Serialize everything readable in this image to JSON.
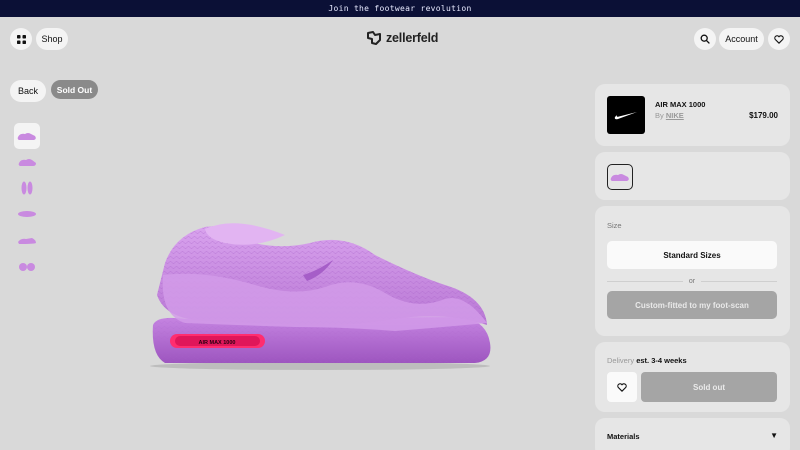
{
  "banner": {
    "text": "Join the footwear revolution"
  },
  "header": {
    "menu_icon": "grid-icon",
    "shop_label": "Shop",
    "brand_name": "zellerfeld",
    "search_icon": "search-icon",
    "account_label": "Account",
    "wishlist_icon": "heart-icon"
  },
  "product_nav": {
    "back_label": "Back",
    "status_badge": "Sold Out"
  },
  "gallery": {
    "thumbnail_count": 6,
    "active_index": 0
  },
  "product": {
    "name": "AIR MAX 1000",
    "by_prefix": "By",
    "brand": "NIKE",
    "price": "$179.00",
    "air_unit_text": "AIR MAX 1000",
    "color": "#c98ae0"
  },
  "size": {
    "title": "Size",
    "standard_label": "Standard Sizes",
    "or_label": "or",
    "custom_label": "Custom-fitted to my foot-scan"
  },
  "delivery": {
    "label": "Delivery",
    "estimate": "est. 3-4 weeks",
    "sold_out_label": "Sold out"
  },
  "materials": {
    "title": "Materials",
    "caret": "▼"
  },
  "colors": {
    "banner_bg": "#0b1036",
    "page_bg": "#d9d9d9",
    "shoe_purple": "#c98ae0",
    "air_unit_pink": "#ff2d6f",
    "disabled_button": "#a5a5a5"
  }
}
